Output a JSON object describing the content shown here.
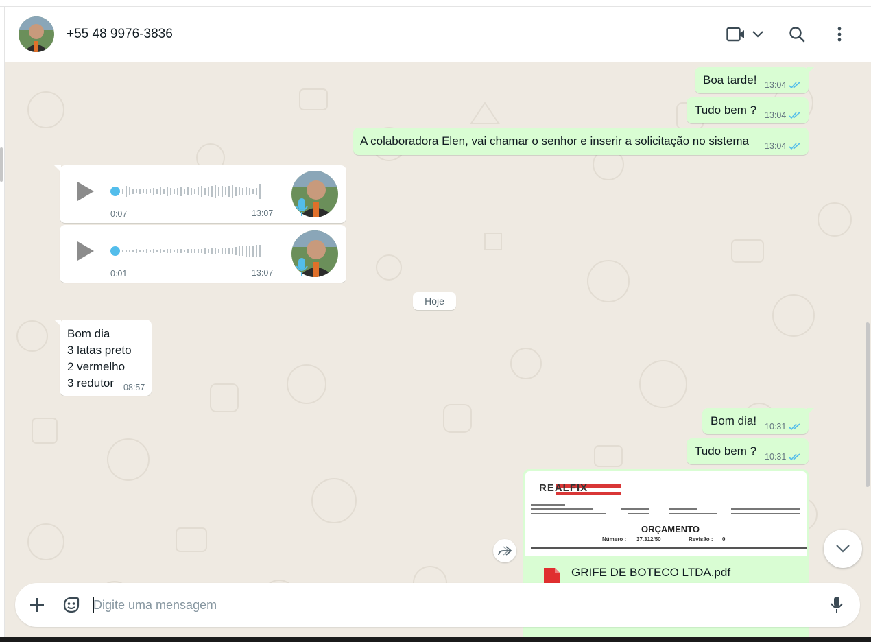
{
  "header": {
    "contact_name": "+55 48 9976-3836",
    "icons": [
      "video-call-icon",
      "chevron-down-icon",
      "search-icon",
      "menu-icon"
    ]
  },
  "messages": [
    {
      "text": "Boa tarde!",
      "time": "13:04",
      "direction": "out"
    },
    {
      "text": "Tudo bem ?",
      "time": "13:04",
      "direction": "out"
    },
    {
      "text": "A colaboradora Elen, vai chamar o senhor e inserir a solicitação no sistema",
      "time": "13:04",
      "direction": "out"
    }
  ],
  "audios": [
    {
      "duration": "0:07",
      "time": "13:07"
    },
    {
      "duration": "0:01",
      "time": "13:07"
    }
  ],
  "day_divider": "Hoje",
  "incoming_list": {
    "lines": [
      "Bom dia",
      "3 latas preto",
      "2 vermelho",
      "3 redutor"
    ],
    "time": "08:57"
  },
  "messages_today": [
    {
      "text": "Bom dia!",
      "time": "10:31",
      "direction": "out"
    },
    {
      "text": "Tudo bem ?",
      "time": "10:31",
      "direction": "out"
    }
  ],
  "document": {
    "file_name": "GRIFE DE BOTECO LTDA.pdf",
    "preview": {
      "brand": "REALFIX",
      "title": "ORÇAMENTO",
      "number_label": "Número :",
      "number_value": "37.312/50",
      "revision_label": "Revisão :",
      "revision_value": "0"
    }
  },
  "composer": {
    "placeholder": "Digite uma mensagem"
  },
  "colors": {
    "outgoing_bubble": "#d9fdd3",
    "incoming_bubble": "#ffffff",
    "chat_background": "#efeae2",
    "read_ticks": "#53bdeb"
  }
}
